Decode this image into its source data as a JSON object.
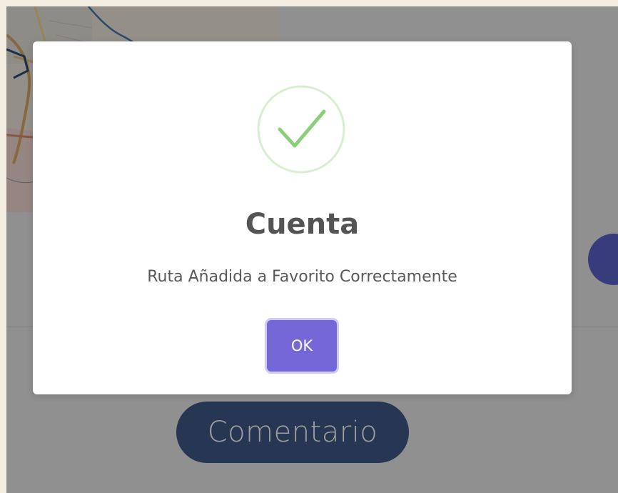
{
  "dialog": {
    "icon": "success-check-icon",
    "title": "Cuenta",
    "message": "Ruta Añadida a Favorito Correctamente",
    "ok_label": "OK"
  },
  "background": {
    "comment_label": "Comentario",
    "map_icon": "map-view"
  },
  "colors": {
    "overlay": "rgba(0,0,0,0.38)",
    "ok_button": "#7468d8",
    "success_green": "#8ccf7b",
    "comment_button": "#3f5a86",
    "fab": "#5a62c8"
  }
}
